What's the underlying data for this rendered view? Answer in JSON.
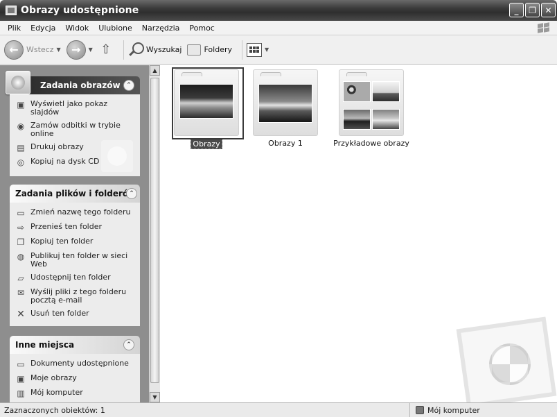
{
  "window": {
    "title": "Obrazy udostępnione"
  },
  "menu": [
    "Plik",
    "Edycja",
    "Widok",
    "Ulubione",
    "Narzędzia",
    "Pomoc"
  ],
  "toolbar": {
    "back": "Wstecz",
    "search": "Wyszukaj",
    "folders": "Foldery"
  },
  "sidebar": {
    "picture_tasks": {
      "title": "Zadania obrazów",
      "items": [
        "Wyświetl jako pokaz slajdów",
        "Zamów odbitki w trybie online",
        "Drukuj obrazy",
        "Kopiuj na dysk CD"
      ]
    },
    "file_tasks": {
      "title": "Zadania plików i folderów",
      "items": [
        "Zmień nazwę tego folderu",
        "Przenieś ten folder",
        "Kopiuj ten folder",
        "Publikuj ten folder w sieci Web",
        "Udostępnij ten folder",
        "Wyślij pliki z tego folderu pocztą e-mail",
        "Usuń ten folder"
      ]
    },
    "other_places": {
      "title": "Inne miejsca",
      "items": [
        "Dokumenty udostępnione",
        "Moje obrazy",
        "Mój komputer"
      ]
    }
  },
  "folders": [
    {
      "label": "Obrazy",
      "selected": true
    },
    {
      "label": "Obrazy 1",
      "selected": false
    },
    {
      "label": "Przykładowe obrazy",
      "selected": false
    }
  ],
  "status": {
    "left": "Zaznaczonych obiektów: 1",
    "right": "Mój komputer"
  },
  "icons": {
    "title": "shared-pictures-icon",
    "back": "back-arrow-icon",
    "forward": "forward-arrow-icon",
    "up": "folder-up-icon",
    "search": "magnifier-icon",
    "folders": "folders-icon",
    "views": "views-icon"
  }
}
